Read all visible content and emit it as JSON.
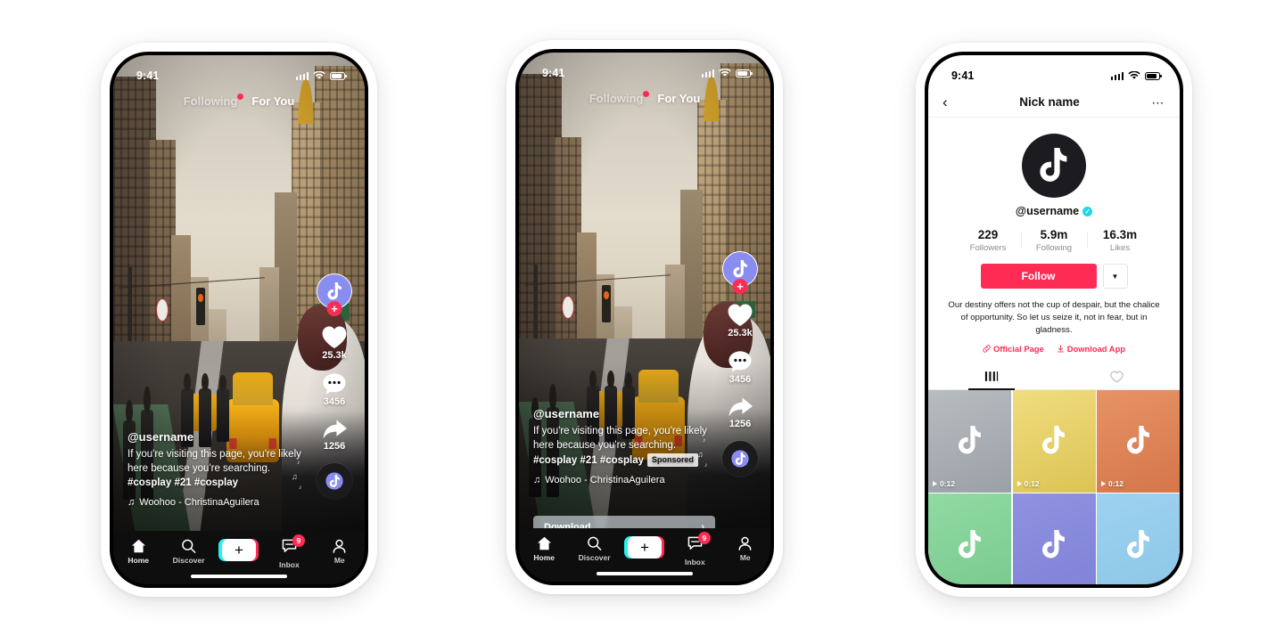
{
  "status_bar": {
    "time": "9:41",
    "signal_icon": "cellular-bars-icon",
    "wifi_icon": "wifi-icon",
    "battery_icon": "battery-icon"
  },
  "feed": {
    "tabs": [
      {
        "label": "Following",
        "active": false,
        "has_dot": true
      },
      {
        "label": "For You",
        "active": true,
        "has_dot": false
      }
    ],
    "actions": {
      "avatar_icon": "tiktok-note-icon",
      "follow_plus": "+",
      "like_icon": "heart-icon",
      "like_count": "25.3k",
      "comment_icon": "comment-dots-icon",
      "comment_count": "3456",
      "share_icon": "share-arrow-icon",
      "share_count": "1256",
      "music_disc_icon": "music-disc-icon"
    },
    "caption": {
      "username": "@username",
      "line1": "If you're visiting this page, you're likely",
      "line2": "here because you're searching. ",
      "hashtag1": "#cosplay",
      "line3": "#21 #cosplay",
      "sponsored_label": "Sponsored",
      "music_icon": "music-note-icon",
      "music": "Woohoo - ChristinaAguilera"
    },
    "cta": {
      "label": "Download",
      "chevron": "›"
    },
    "nav": [
      {
        "label": "Home",
        "icon": "home-icon"
      },
      {
        "label": "Discover",
        "icon": "search-icon"
      },
      {
        "label": "",
        "icon": "create-plus-icon"
      },
      {
        "label": "Inbox",
        "icon": "inbox-icon",
        "badge": "9"
      },
      {
        "label": "Me",
        "icon": "person-icon"
      }
    ]
  },
  "profile": {
    "back_icon": "chevron-left-icon",
    "title": "Nick name",
    "more_icon": "more-dots-icon",
    "avatar_icon": "tiktok-note-icon",
    "username": "@username",
    "verified_icon": "verified-check-icon",
    "stats": [
      {
        "value": "229",
        "label": "Followers"
      },
      {
        "value": "5.9m",
        "label": "Following"
      },
      {
        "value": "16.3m",
        "label": "Likes"
      }
    ],
    "follow_label": "Follow",
    "dropdown_icon": "chevron-down-icon",
    "bio_line1": "Our destiny offers not the cup of despair, but",
    "bio_line2": "the chalice of opportunity. So let us seize it, not",
    "bio_line3": "in fear, but in gladness.",
    "links": [
      {
        "label": "Official Page",
        "icon": "link-icon"
      },
      {
        "label": "Download App",
        "icon": "download-icon"
      }
    ],
    "tabs": [
      {
        "icon": "grid-posts-icon",
        "active": true
      },
      {
        "icon": "heart-liked-icon",
        "active": false
      }
    ],
    "grid": [
      {
        "color_start": "#b7bcc0",
        "color_end": "#9aa1a6",
        "duration": "0:12",
        "play_icon": "play-icon"
      },
      {
        "color_start": "#f0dd7f",
        "color_end": "#dcc354",
        "duration": "0:12",
        "play_icon": "play-icon"
      },
      {
        "color_start": "#e79366",
        "color_end": "#d4764a",
        "duration": "0:12",
        "play_icon": "play-icon"
      },
      {
        "color_start": "#8fdba3",
        "color_end": "#7bc98f",
        "duration": "",
        "play_icon": "play-icon"
      },
      {
        "color_start": "#8f92e0",
        "color_end": "#7f82d6",
        "duration": "",
        "play_icon": "play-icon"
      },
      {
        "color_start": "#9ed2ef",
        "color_end": "#8cc6e8",
        "duration": "",
        "play_icon": "play-icon"
      }
    ]
  },
  "colors": {
    "brand_red": "#fe2c55",
    "brand_cyan": "#25f4ee",
    "verified_blue": "#20d5ec",
    "nav_bg": "#0e0e0f"
  }
}
